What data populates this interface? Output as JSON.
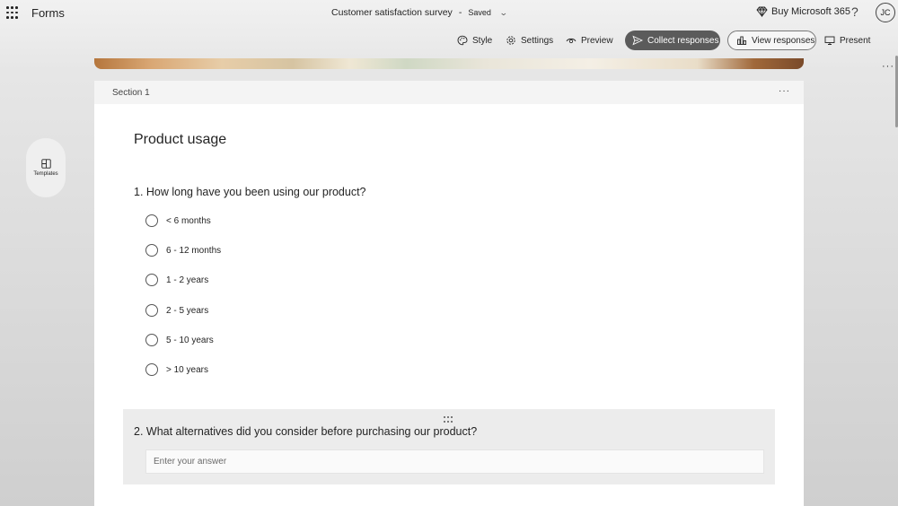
{
  "app": {
    "name": "Forms"
  },
  "document": {
    "title": "Customer satisfaction survey",
    "separator": "-",
    "status": "Saved"
  },
  "header": {
    "buy_label": "Buy Microsoft 365",
    "help_label": "?",
    "avatar_initials": "JC"
  },
  "toolbar": {
    "style": "Style",
    "settings": "Settings",
    "preview": "Preview",
    "collect": "Collect responses",
    "view": "View responses",
    "present": "Present",
    "more": "···"
  },
  "sidebar": {
    "templates_label": "Templates"
  },
  "section": {
    "label": "Section 1",
    "more": "···"
  },
  "form": {
    "title": "Product usage",
    "question1": {
      "text": "1. How long have you been using our product?",
      "options": [
        "< 6 months",
        "6 - 12 months",
        "1 - 2 years",
        "2 - 5 years",
        "5 - 10 years",
        "> 10 years"
      ]
    },
    "question2": {
      "text": "2. What alternatives did you consider before purchasing our product?",
      "placeholder": "Enter your answer"
    }
  },
  "colors": {
    "collect_bg": "#5b5b5b",
    "page_bg": "#e6e6e6",
    "card_bg": "#ffffff",
    "question_active_bg": "#ececec"
  },
  "icons": {
    "waffle": "app-launcher-icon",
    "buy": "diamond-icon",
    "style": "palette-icon",
    "settings": "gear-icon",
    "preview": "eye-icon",
    "collect": "send-icon",
    "view": "chart-icon",
    "present": "monitor-icon",
    "templates": "layout-icon"
  }
}
